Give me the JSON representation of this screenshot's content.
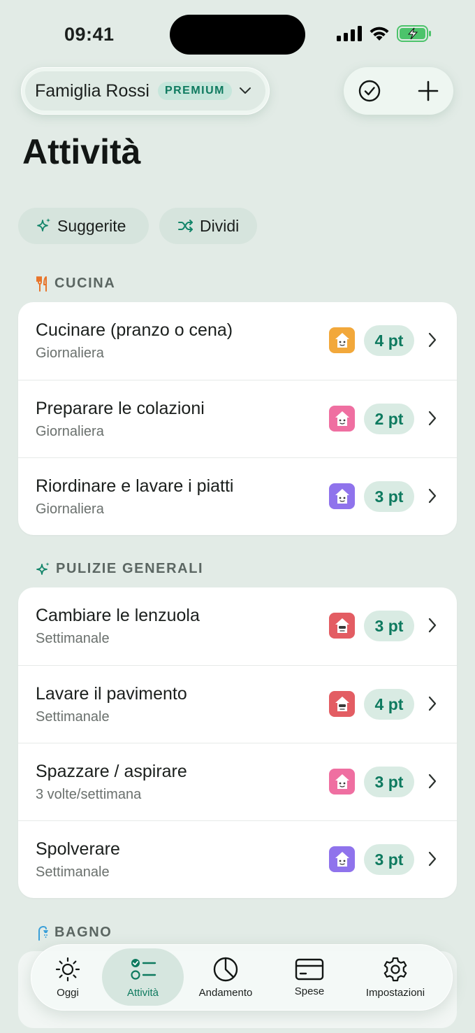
{
  "status": {
    "time": "09:41"
  },
  "header": {
    "family_name": "Famiglia Rossi",
    "premium_label": "PREMIUM",
    "title": "Attività"
  },
  "chips": {
    "suggest": "Suggerite",
    "split": "Dividi"
  },
  "sections": {
    "kitchen": {
      "label": "CUCINA",
      "rows": [
        {
          "title": "Cucinare (pranzo o cena)",
          "freq": "Giornaliera",
          "points": "4 pt",
          "avatar_color": "#f2a83b"
        },
        {
          "title": "Preparare le colazioni",
          "freq": "Giornaliera",
          "points": "2 pt",
          "avatar_color": "#ef6fa1"
        },
        {
          "title": "Riordinare e lavare i piatti",
          "freq": "Giornaliera",
          "points": "3 pt",
          "avatar_color": "#8f73ec"
        }
      ]
    },
    "cleaning": {
      "label": "PULIZIE GENERALI",
      "rows": [
        {
          "title": "Cambiare le lenzuola",
          "freq": "Settimanale",
          "points": "3 pt",
          "avatar_color": "#e35d63"
        },
        {
          "title": "Lavare il pavimento",
          "freq": "Settimanale",
          "points": "4 pt",
          "avatar_color": "#e35d63"
        },
        {
          "title": "Spazzare / aspirare",
          "freq": "3 volte/settimana",
          "points": "3 pt",
          "avatar_color": "#ef6fa1"
        },
        {
          "title": "Spolverare",
          "freq": "Settimanale",
          "points": "3 pt",
          "avatar_color": "#8f73ec"
        }
      ]
    },
    "bathroom": {
      "label": "BAGNO"
    }
  },
  "tabs": {
    "today": "Oggi",
    "activities": "Attività",
    "progress": "Andamento",
    "expenses": "Spese",
    "settings": "Impostazioni"
  },
  "colors": {
    "accent": "#0e7a5f",
    "background": "#e2ebe6"
  }
}
